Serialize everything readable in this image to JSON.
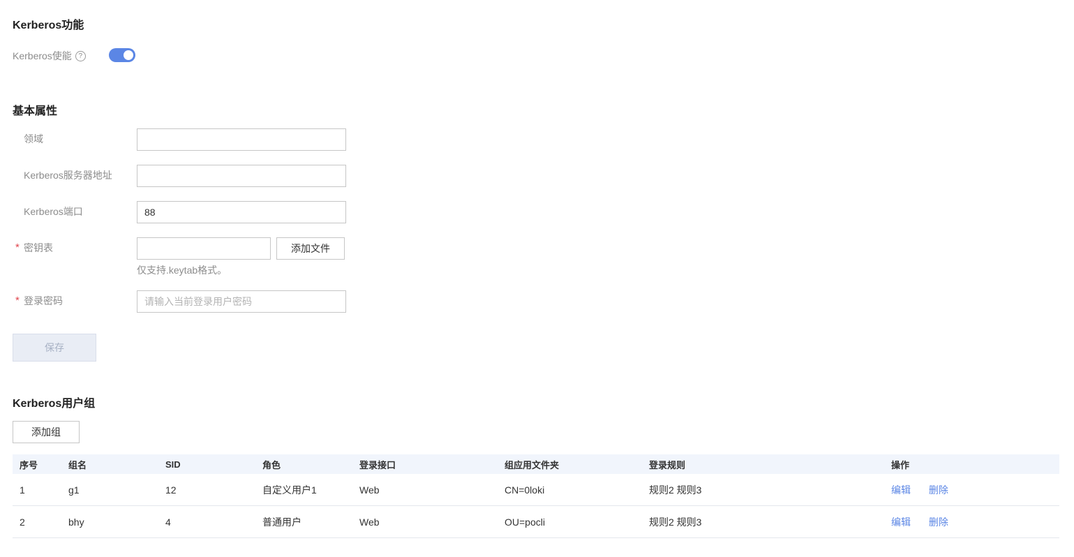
{
  "kerberos": {
    "title": "Kerberos功能",
    "enable_label": "Kerberos使能",
    "help_glyph": "?",
    "enabled": true
  },
  "basic": {
    "title": "基本属性",
    "realm_label": "领域",
    "realm_value": "",
    "server_label": "Kerberos服务器地址",
    "server_value": "",
    "port_label": "Kerberos端口",
    "port_value": "88",
    "required_mark": "*",
    "keytab_label": "密钥表",
    "keytab_value": "",
    "add_file_button": "添加文件",
    "keytab_hint": "仅支持.keytab格式。",
    "password_label": "登录密码",
    "password_placeholder": "请输入当前登录用户密码",
    "save_button": "保存"
  },
  "groups": {
    "title": "Kerberos用户组",
    "add_button": "添加组",
    "columns": [
      "序号",
      "组名",
      "SID",
      "角色",
      "登录接口",
      "组应用文件夹",
      "登录规则",
      "操作"
    ],
    "rows": [
      {
        "index": "1",
        "name": "g1",
        "sid": "12",
        "role": "自定义用户1",
        "iface": "Web",
        "folder": "CN=0loki",
        "rules": "规则2 规则3",
        "edit": "编辑",
        "delete": "删除"
      },
      {
        "index": "2",
        "name": "bhy",
        "sid": "4",
        "role": "普通用户",
        "iface": "Web",
        "folder": "OU=pocli",
        "rules": "规则2 规则3",
        "edit": "编辑",
        "delete": "删除"
      }
    ]
  },
  "colors": {
    "accent": "#5b86e5",
    "required": "#e0464e",
    "header_bg": "#f1f5fc"
  }
}
